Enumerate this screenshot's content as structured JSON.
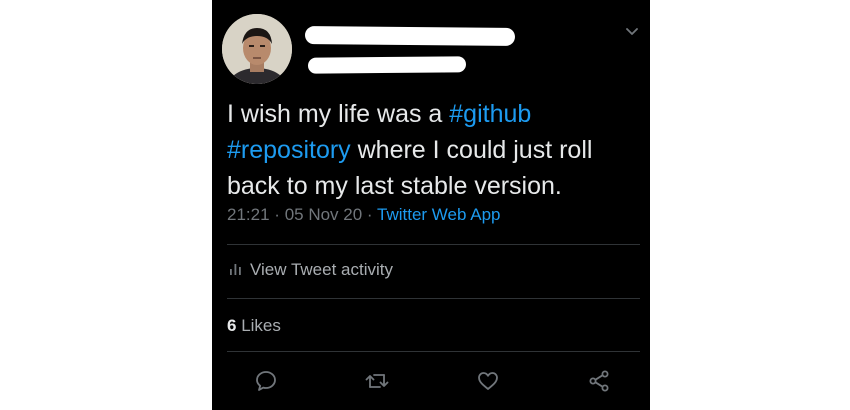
{
  "tweet": {
    "text_lines": [
      {
        "before": "I wish my life was a ",
        "hashtag": "#github",
        "after": ""
      },
      {
        "before": "",
        "hashtag": "#repository",
        "after": " where I could just roll"
      },
      {
        "before": "back to my last stable version.",
        "hashtag": "",
        "after": ""
      }
    ],
    "time": "21:21",
    "separator": "·",
    "date": "05 Nov 20",
    "source": "Twitter Web App"
  },
  "activity": {
    "label": "View Tweet activity"
  },
  "likes": {
    "count": "6",
    "label": "Likes"
  },
  "icons": {
    "menu": "chevron-down-icon",
    "activity": "bar-chart-icon",
    "reply": "reply-icon",
    "retweet": "retweet-icon",
    "like": "heart-icon",
    "share": "share-icon"
  },
  "colors": {
    "background": "#000000",
    "text": "#e7e9ea",
    "muted": "#71767b",
    "accent": "#1d9bf0",
    "divider": "#2f3336"
  }
}
